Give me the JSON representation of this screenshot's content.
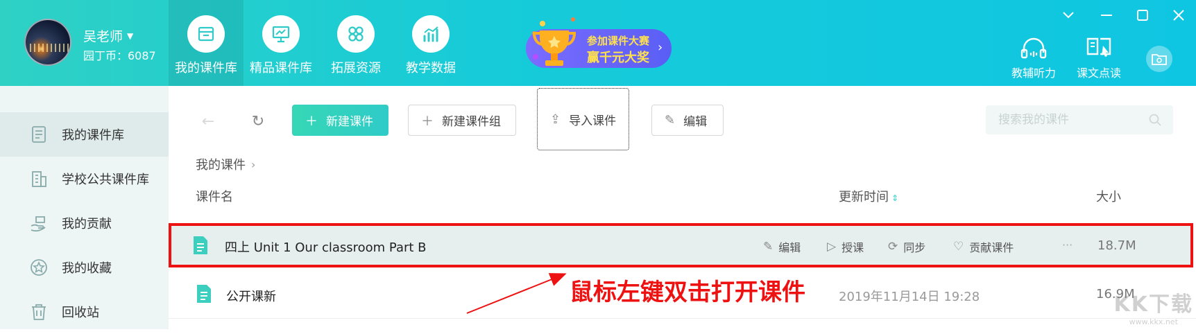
{
  "user": {
    "name": "吴老师",
    "coins": "园丁币：6087"
  },
  "nav_tabs": [
    {
      "label": "我的课件库",
      "icon": "courseware-box-icon",
      "active": true
    },
    {
      "label": "精品课件库",
      "icon": "presentation-board-icon",
      "active": false
    },
    {
      "label": "拓展资源",
      "icon": "apps-grid-icon",
      "active": false
    },
    {
      "label": "教学数据",
      "icon": "bar-chart-icon",
      "active": false
    }
  ],
  "promo": {
    "line1": "参加课件大赛",
    "line2": "赢千元大奖"
  },
  "tools": {
    "listening": "教辅听力",
    "reading": "课文点读"
  },
  "sidebar": {
    "items": [
      {
        "label": "我的课件库",
        "icon": "document-list-icon",
        "active": true
      },
      {
        "label": "学校公共课件库",
        "icon": "building-icon",
        "active": false
      },
      {
        "label": "我的贡献",
        "icon": "hand-give-icon",
        "active": false
      },
      {
        "label": "我的收藏",
        "icon": "star-circle-icon",
        "active": false
      },
      {
        "label": "回收站",
        "icon": "trash-icon",
        "active": false
      }
    ]
  },
  "toolbar": {
    "new_courseware": "新建课件",
    "new_group": "新建课件组",
    "import": "导入课件",
    "edit": "编辑",
    "search_placeholder": "搜索我的课件"
  },
  "breadcrumb": {
    "current": "我的课件"
  },
  "columns": {
    "name": "课件名",
    "updated": "更新时间",
    "size": "大小"
  },
  "rows": [
    {
      "name": "四上 Unit 1 Our classroom Part B",
      "actions": {
        "edit": "编辑",
        "teach": "授课",
        "sync": "同步",
        "contribute": "贡献课件",
        "more": "···"
      },
      "size": "18.7M",
      "selected": true
    },
    {
      "name": "公开课新",
      "updated": "2019年11月14日 19:28",
      "size": "16.9M",
      "selected": false
    }
  ],
  "annotation": "鼠标左键双击打开课件",
  "watermark": {
    "line1": "KK下载",
    "line2": "www.kkx.net"
  },
  "colors": {
    "accent": "#2fcbc8",
    "highlight_border": "#ee1111",
    "annotation": "#ee1111"
  }
}
